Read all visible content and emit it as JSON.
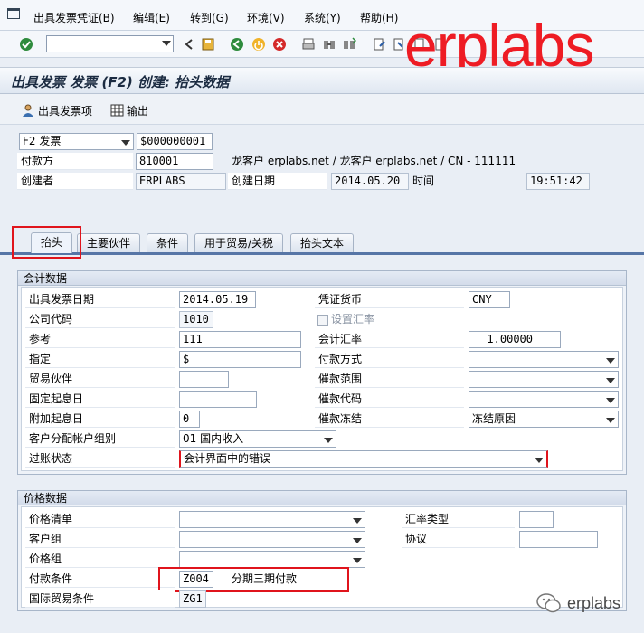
{
  "menu": {
    "items": [
      "出具发票凭证(B)",
      "编辑(E)",
      "转到(G)",
      "环境(V)",
      "系统(Y)",
      "帮助(H)"
    ]
  },
  "toolbar": {
    "command_value": "",
    "icons": [
      "enter-icon",
      "back-icon",
      "save-icon",
      "back-nav-icon",
      "exit-icon",
      "cancel-icon",
      "print-icon",
      "find-icon",
      "find-next-icon",
      "first-page-icon",
      "prev-page-icon",
      "next-page-icon"
    ]
  },
  "watermark": {
    "top": "erplabs",
    "bottom": "erplabs"
  },
  "title": "出具发票 发票 (F2) 创建: 抬头数据",
  "appbar": {
    "items_label": "出具发票项",
    "output_label": "输出"
  },
  "header": {
    "billing_type": "F2 发票",
    "billing_doc": "$000000001",
    "payer_label": "付款方",
    "payer_value": "810001",
    "payer_desc": "龙客户 erplabs.net / 龙客户 erplabs.net / CN - 111111",
    "created_by_label": "创建者",
    "created_by_value": "ERPLABS",
    "created_on_label": "创建日期",
    "created_on_value": "2014.05.20",
    "time_label": "时间",
    "time_value": "19:51:42"
  },
  "tabs": [
    "抬头",
    "主要伙伴",
    "条件",
    "用于贸易/关税",
    "抬头文本"
  ],
  "accounting": {
    "title": "会计数据",
    "billing_date_label": "出具发票日期",
    "billing_date_value": "2014.05.19",
    "doc_currency_label": "凭证货币",
    "doc_currency_value": "CNY",
    "company_code_label": "公司代码",
    "company_code_value": "1010",
    "set_rate_label": "设置汇率",
    "reference_label": "参考",
    "reference_value": "111",
    "exchange_rate_label": "会计汇率",
    "exchange_rate_value": "1.00000",
    "assignment_label": "指定",
    "assignment_value": "$",
    "payment_method_label": "付款方式",
    "payment_method_value": "",
    "trading_partner_label": "贸易伙伴",
    "trading_partner_value": "",
    "dunning_area_label": "催款范围",
    "dunning_area_value": "",
    "fixed_baseline_label": "固定起息日",
    "fixed_baseline_value": "",
    "dunning_key_label": "催款代码",
    "dunning_key_value": "",
    "additional_days_label": "附加起息日",
    "additional_days_value": "0",
    "dunning_block_label": "催款冻结",
    "dunning_block_value": "冻结原因",
    "acct_group_label": "客户分配帐户组别",
    "acct_group_value": "01 国内收入",
    "posting_status_label": "过账状态",
    "posting_status_value": "会计界面中的错误"
  },
  "pricing": {
    "title": "价格数据",
    "price_list_label": "价格清单",
    "price_list_value": "",
    "exch_rate_type_label": "汇率类型",
    "exch_rate_type_value": "",
    "customer_group_label": "客户组",
    "customer_group_value": "",
    "agreement_label": "协议",
    "agreement_value": "",
    "price_group_label": "价格组",
    "price_group_value": "",
    "payment_terms_label": "付款条件",
    "payment_terms_value": "Z004",
    "payment_terms_desc": "分期三期付款",
    "incoterms_label": "国际贸易条件",
    "incoterms_value": "ZG1"
  },
  "colors": {
    "highlight": "#e0141c",
    "tab_line": "#5675a6"
  }
}
